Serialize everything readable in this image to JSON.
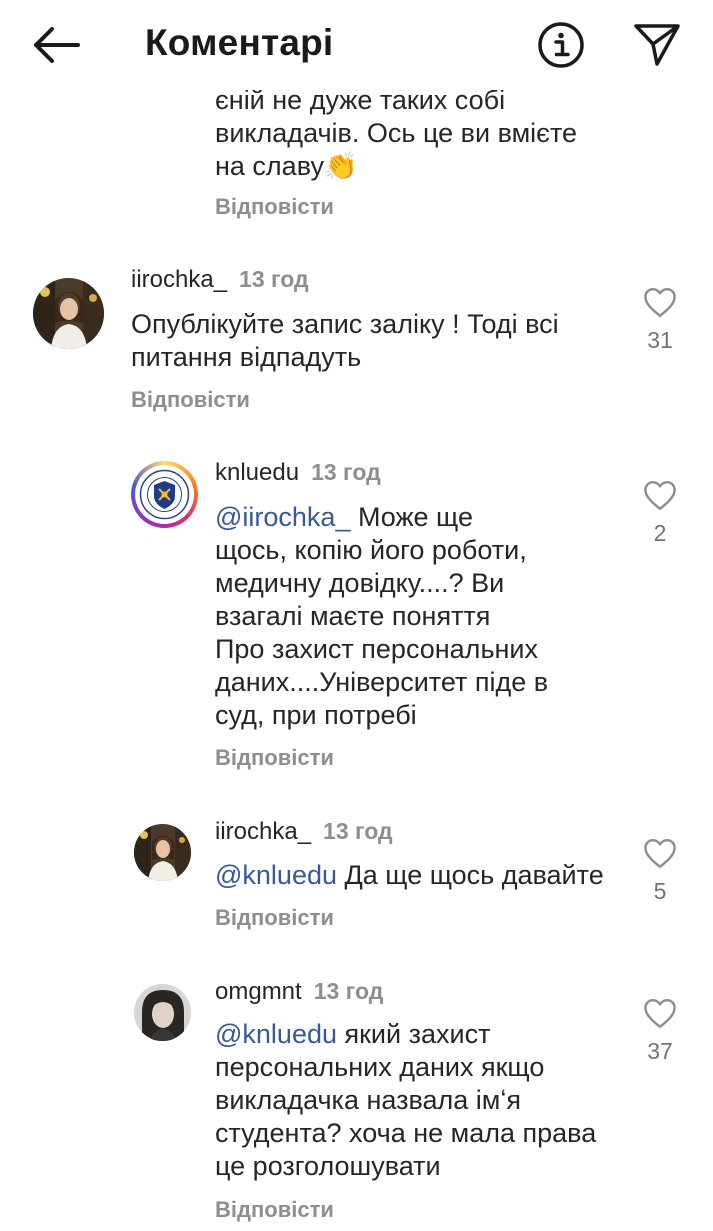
{
  "header": {
    "title": "Коментарі",
    "back_icon": "arrow-left-icon",
    "info_icon": "info-icon",
    "send_icon": "send-icon"
  },
  "partial_comment": {
    "line0": "єній не дуже таких собі",
    "line1": "викладачів. Ось це ви вмієте",
    "line2_text": "на славу",
    "line2_emoji": "👏",
    "reply": "Відповісти"
  },
  "comments": [
    {
      "username": "iirochka_",
      "time": "13 год",
      "text": [
        "Опублікуйте запис заліку ! Тоді всі",
        "питання відпадуть"
      ],
      "likes": "31",
      "reply": "Відповісти"
    },
    {
      "username": "knluedu",
      "time": "13 год",
      "mention": "@iirochka_",
      "text": [
        " Може ще",
        "щось, копію його роботи,",
        "медичну довідку....? Ви",
        "взагалі маєте поняття",
        "Про захист персональних",
        "даних....Університет піде в",
        "суд, при потребі"
      ],
      "likes": "2",
      "reply": "Відповісти"
    },
    {
      "username": "iirochka_",
      "time": "13 год",
      "mention": "@knluedu",
      "text": [
        " Да ще щось давайте"
      ],
      "likes": "5",
      "reply": "Відповісти"
    },
    {
      "username": "omgmnt",
      "time": "13 год",
      "mention": "@knluedu",
      "text": [
        " який захист",
        "персональних даних якщо",
        "викладачка назвала імʻя",
        "студента? хоча не мала права",
        "це розголошувати"
      ],
      "likes": "37",
      "reply": "Відповісти"
    }
  ],
  "colors": {
    "text": "#262626",
    "muted": "#8e8e8e",
    "mention": "#385898",
    "background": "#ffffff"
  }
}
